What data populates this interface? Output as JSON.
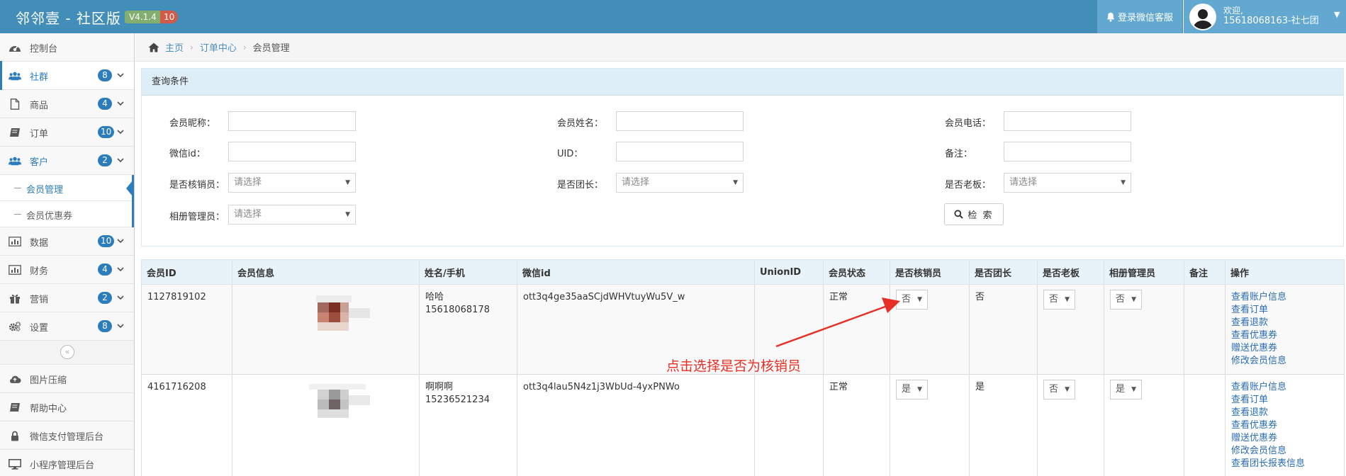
{
  "app": {
    "brand": "邻邻壹 - 社区版",
    "version": "V4.1.4",
    "notify_count": "10",
    "service_label": "登录微信客服",
    "welcome": "欢迎,",
    "username": "15618068163-社七团"
  },
  "sidebar": {
    "items": [
      {
        "label": "控制台",
        "icon": "dashboard-icon",
        "badge": "",
        "chevron": false
      },
      {
        "label": "社群",
        "icon": "users-icon",
        "badge": "8",
        "chevron": true
      },
      {
        "label": "商品",
        "icon": "file-icon",
        "badge": "4",
        "chevron": true
      },
      {
        "label": "订单",
        "icon": "book-icon",
        "badge": "10",
        "chevron": true
      },
      {
        "label": "客户",
        "icon": "users-icon",
        "badge": "2",
        "chevron": true
      },
      {
        "label": "数据",
        "icon": "bar-chart-icon",
        "badge": "10",
        "chevron": true
      },
      {
        "label": "财务",
        "icon": "bar-chart-icon",
        "badge": "4",
        "chevron": true
      },
      {
        "label": "营销",
        "icon": "gift-icon",
        "badge": "2",
        "chevron": true
      },
      {
        "label": "设置",
        "icon": "gears-icon",
        "badge": "8",
        "chevron": true
      },
      {
        "label": "图片压缩",
        "icon": "cloud-upload-icon",
        "badge": "",
        "chevron": false
      },
      {
        "label": "帮助中心",
        "icon": "book-icon",
        "badge": "",
        "chevron": false
      },
      {
        "label": "微信支付管理后台",
        "icon": "lock-icon",
        "badge": "",
        "chevron": false
      },
      {
        "label": "小程序管理后台",
        "icon": "desktop-icon",
        "badge": "",
        "chevron": false
      }
    ],
    "sub_items": [
      {
        "label": "会员管理"
      },
      {
        "label": "会员优惠券"
      }
    ],
    "collapse_glyph": "«"
  },
  "breadcrumb": {
    "home": "主页",
    "section": "订单中心",
    "current": "会员管理",
    "sep": "›"
  },
  "query": {
    "title": "查询条件",
    "fields": {
      "nickname": "会员昵称：",
      "name": "会员姓名：",
      "phone": "会员电话：",
      "wechat_id": "微信id：",
      "uid": "UID：",
      "remark": "备注：",
      "is_verifier": "是否核销员：",
      "is_leader": "是否团长：",
      "is_boss": "是否老板：",
      "album_admin": "相册管理员："
    },
    "select_placeholder": "请选择",
    "search_label": "检 索"
  },
  "table": {
    "columns": [
      "会员ID",
      "会员信息",
      "姓名/手机",
      "微信id",
      "UnionID",
      "会员状态",
      "是否核销员",
      "是否团长",
      "是否老板",
      "相册管理员",
      "备注",
      "操作"
    ],
    "rows": [
      {
        "id": "1127819102",
        "name": "哈哈",
        "phone": "15618068178",
        "wechat_id": "ott3q4ge35aaSCjdWHVtuyWu5V_w",
        "union_id": "",
        "status": "正常",
        "is_verifier": "否",
        "is_leader": "否",
        "is_boss": "否",
        "album_admin": "否",
        "remark": "",
        "actions": [
          "查看账户信息",
          "查看订单",
          "查看退款",
          "查看优惠券",
          "赠送优惠券",
          "修改会员信息"
        ]
      },
      {
        "id": "4161716208",
        "name": "啊啊啊",
        "phone": "15236521234",
        "wechat_id": "ott3q4lau5N4z1j3WbUd-4yxPNWo",
        "union_id": "",
        "status": "正常",
        "is_verifier": "是",
        "is_leader": "是",
        "is_boss": "否",
        "album_admin": "是",
        "remark": "",
        "actions": [
          "查看账户信息",
          "查看订单",
          "查看退款",
          "查看优惠券",
          "赠送优惠券",
          "修改会员信息",
          "查看团长报表信息"
        ]
      }
    ]
  },
  "annotation": {
    "text": "点击选择是否为核销员",
    "color": "#e63026"
  },
  "colors": {
    "navbar": "#438eb9",
    "navbar_right": "#62a8d1",
    "accent": "#2b7dbc",
    "version_badge": "#82af6f",
    "count_badge": "#d15b47",
    "link": "#2a6db2"
  }
}
